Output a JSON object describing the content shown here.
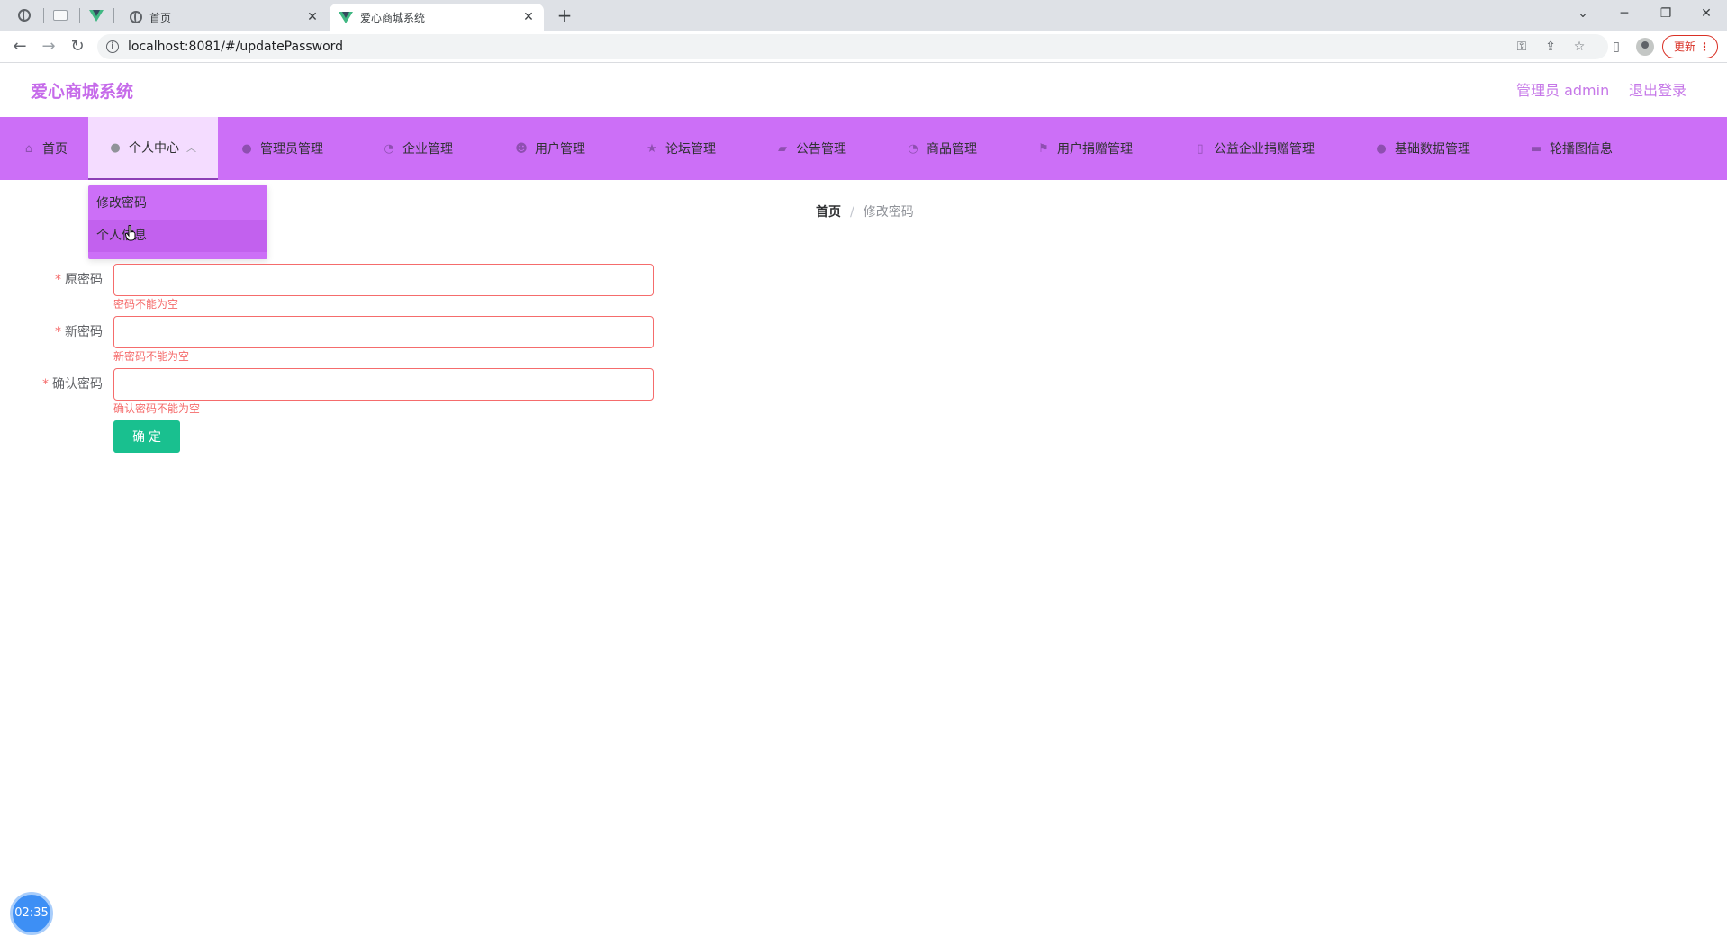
{
  "browser": {
    "tabs": [
      {
        "title": "首页",
        "active": false,
        "favicon": "globe-icon"
      },
      {
        "title": "爱心商城系统",
        "active": true,
        "favicon": "vue-icon"
      }
    ],
    "url": "localhost:8081/#/updatePassword",
    "update_label": "更新"
  },
  "header": {
    "title": "爱心商城系统",
    "user_label": "管理员 admin",
    "logout_label": "退出登录"
  },
  "menu": {
    "items": [
      {
        "label": "首页",
        "icon": "home-icon"
      },
      {
        "label": "个人中心",
        "icon": "user-icon",
        "active": true
      },
      {
        "label": "管理员管理",
        "icon": "user-icon"
      },
      {
        "label": "企业管理",
        "icon": "clock-icon"
      },
      {
        "label": "用户管理",
        "icon": "users-icon"
      },
      {
        "label": "论坛管理",
        "icon": "star-icon"
      },
      {
        "label": "公告管理",
        "icon": "folder-icon"
      },
      {
        "label": "商品管理",
        "icon": "clock-icon"
      },
      {
        "label": "用户捐赠管理",
        "icon": "flag-icon"
      },
      {
        "label": "公益企业捐赠管理",
        "icon": "document-icon"
      },
      {
        "label": "基础数据管理",
        "icon": "user-icon"
      },
      {
        "label": "轮播图信息",
        "icon": "chat-icon"
      }
    ],
    "submenu": [
      {
        "label": "修改密码"
      },
      {
        "label": "个人信息"
      }
    ]
  },
  "breadcrumb": {
    "home": "首页",
    "separator": "/",
    "current": "修改密码"
  },
  "form": {
    "fields": [
      {
        "label": "原密码",
        "value": "",
        "error": "密码不能为空"
      },
      {
        "label": "新密码",
        "value": "",
        "error": "新密码不能为空"
      },
      {
        "label": "确认密码",
        "value": "",
        "error": "确认密码不能为空"
      }
    ],
    "required_mark": "*",
    "submit_label": "确定"
  },
  "timer": "02:35",
  "colors": {
    "brand": "#cc6ff7",
    "title": "#c66bea",
    "error": "#f56c6c",
    "submit": "#19c08f"
  }
}
